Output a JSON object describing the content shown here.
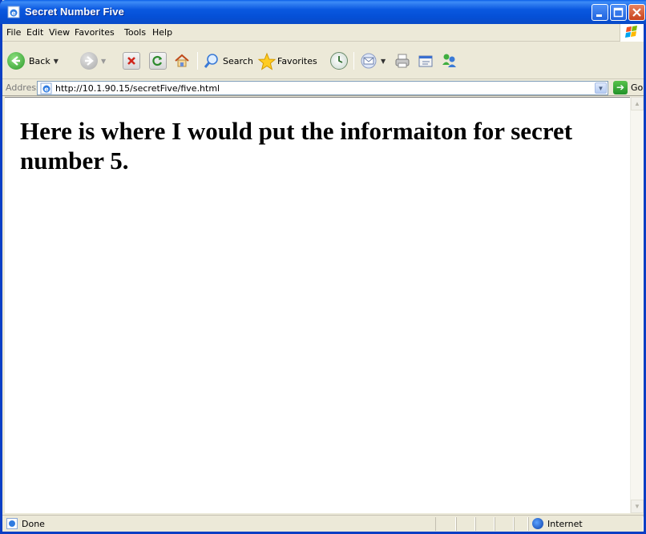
{
  "window": {
    "title": "Secret Number Five"
  },
  "menu": {
    "items": [
      {
        "label": "File"
      },
      {
        "label": "Edit"
      },
      {
        "label": "View"
      },
      {
        "label": "Favorites"
      },
      {
        "label": "Tools"
      },
      {
        "label": "Help"
      }
    ]
  },
  "toolbar": {
    "back_label": "Back",
    "search_label": "Search",
    "favorites_label": "Favorites"
  },
  "address": {
    "label": "Address",
    "url": "http://10.1.90.15/secretFive/five.html",
    "go_label": "Go"
  },
  "page": {
    "heading": "Here is where I would put the informaiton for secret number 5."
  },
  "status": {
    "text": "Done",
    "zone": "Internet"
  },
  "colors": {
    "titlebar": "#0a58e0",
    "chrome": "#ece9d8",
    "content_bg": "#ffffff"
  },
  "icons": [
    "ie-page-icon",
    "minimize-icon",
    "maximize-icon",
    "close-icon",
    "windows-logo-icon",
    "back-icon",
    "forward-icon",
    "stop-icon",
    "refresh-icon",
    "home-icon",
    "search-icon",
    "favorites-star-icon",
    "history-icon",
    "mail-icon",
    "print-icon",
    "edit-icon",
    "messenger-icon",
    "go-arrow-icon",
    "internet-zone-icon"
  ]
}
